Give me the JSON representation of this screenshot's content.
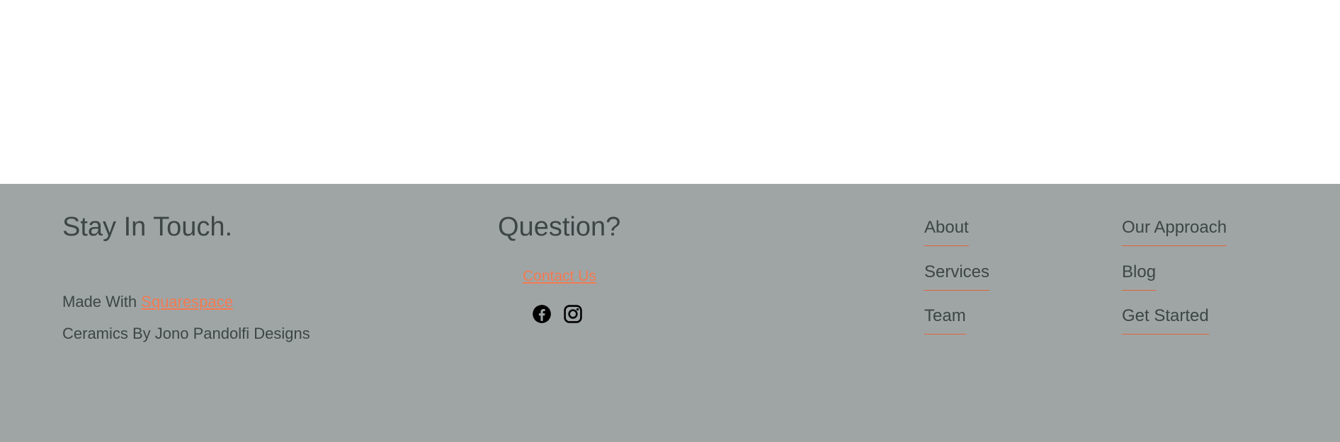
{
  "footer": {
    "left": {
      "heading": "Stay In Touch.",
      "made_with_prefix": "Made With",
      "made_with_link": "Squarespace",
      "credit": "Ceramics By Jono Pandolfi Designs"
    },
    "center": {
      "heading": "Question?",
      "contact_link": "Contact Us",
      "social_icons": [
        "facebook-icon",
        "instagram-icon"
      ]
    },
    "nav": {
      "col1": [
        "About",
        "Services",
        "Team"
      ],
      "col2": [
        "Our Approach",
        "Blog",
        "Get Started"
      ]
    }
  },
  "colors": {
    "footer_background": "#9fa5a5",
    "text": "#3d4545",
    "accent": "#f47a52",
    "nav_underline": "#e0643c"
  }
}
